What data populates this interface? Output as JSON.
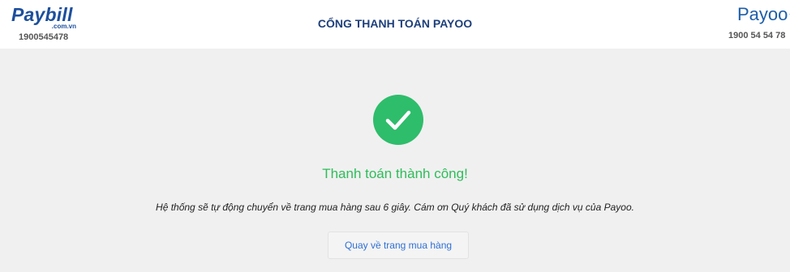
{
  "header": {
    "left_brand": {
      "logo_text": "Paybill",
      "logo_subtext": ".com.vn",
      "hotline": "1900545478"
    },
    "title": "CỔNG THANH TOÁN PAYOO",
    "right_brand": {
      "logo_text": "Payoo",
      "logo_dots": "⁘",
      "hotline": "1900 54 54 78"
    }
  },
  "main": {
    "status_icon": "check-circle-icon",
    "success_title": "Thanh toán thành công!",
    "redirect_message": "Hệ thống sẽ tự động chuyển về trang mua hàng sau 6 giây. Cám ơn Quý khách đã sử dụng dịch vụ của Payoo.",
    "back_button_label": "Quay về trang mua hàng"
  },
  "colors": {
    "success_green": "#2ebd6b",
    "link_blue": "#2f6fd6",
    "brand_navy": "#1d3f7a",
    "background": "#f0f0f0"
  }
}
